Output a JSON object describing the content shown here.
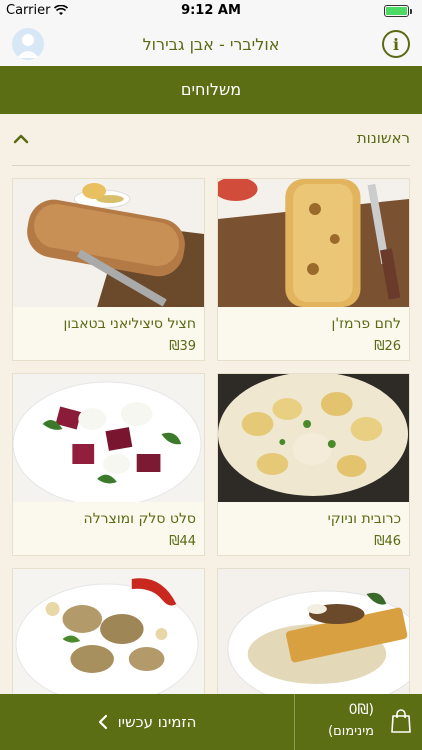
{
  "status_bar": {
    "carrier": "Carrier",
    "time": "9:12 AM"
  },
  "nav": {
    "title": "אוליברי - אבן גבירול",
    "info_label": "i"
  },
  "category": {
    "label": "משלוחים"
  },
  "section": {
    "title": "ראשונות",
    "expanded": true
  },
  "menu_items": [
    {
      "name": "חציל סיציליאני בטאבון",
      "price": "₪39"
    },
    {
      "name": "לחם פרמז'ן",
      "price": "₪26"
    },
    {
      "name": "סלט סלק ומוצרלה",
      "price": "₪44"
    },
    {
      "name": "כרובית וניוקי",
      "price": "₪46"
    },
    {
      "name": "",
      "price": ""
    },
    {
      "name": "",
      "price": ""
    }
  ],
  "bottom": {
    "order_label": "הזמינו עכשיו",
    "cart_amount": "(0₪",
    "cart_minimum": "מינימום)"
  },
  "colors": {
    "brand_green": "#5b6e14",
    "background": "#f6f1e4"
  }
}
